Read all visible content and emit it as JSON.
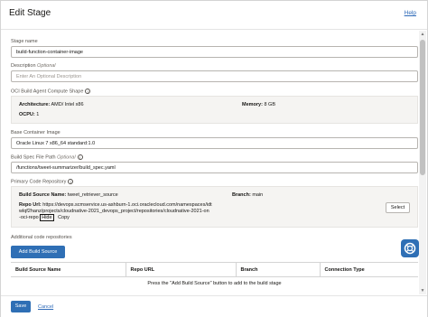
{
  "header": {
    "title": "Edit Stage",
    "help": "Help"
  },
  "stage_name": {
    "label": "Stage name",
    "value": "build-function-container-image"
  },
  "description": {
    "label": "Description",
    "optional": "Optional",
    "placeholder": "Enter An Optional Description"
  },
  "compute_shape": {
    "label": "OCI Build Agent Compute Shape",
    "architecture_label": "Architecture:",
    "architecture_value": "AMD/ Intel x86",
    "memory_label": "Memory:",
    "memory_value": "8 GB",
    "ocpu_label": "OCPU:",
    "ocpu_value": "1"
  },
  "base_image": {
    "label": "Base Container Image",
    "value": "Oracle Linux 7 x86_64 standard:1.0"
  },
  "build_spec": {
    "label": "Build Spec File Path",
    "optional": "Optional",
    "value": "/functions/tweet-summarizer/build_spec.yaml"
  },
  "primary_repo": {
    "label": "Primary Code Repository",
    "source_name_label": "Build Source Name:",
    "source_name_value": "tweet_retriever_source",
    "branch_label": "Branch:",
    "branch_value": "main",
    "repo_url_label": "Repo Url:",
    "repo_url_line1": "https://devops.scmservice.us-ashburn-1.oci.oraclecloud.com/namespaces/idt",
    "repo_url_line2": "wlqf2hanz/projects/cloudnative-2021_devops_project/repositories/cloudnative-2021-on",
    "repo_url_line3": "-oci-repo",
    "hide": "Hide",
    "copy": "Copy",
    "select_button": "Select"
  },
  "additional_repos": {
    "label": "Additional code repositories",
    "add_button": "Add Build Source",
    "columns": [
      "Build Source Name",
      "Repo URL",
      "Branch",
      "Connection Type"
    ],
    "empty_message": "Press the \"Add Build Source\" button to add to the build stage"
  },
  "footer": {
    "save": "Save",
    "cancel": "Cancel"
  },
  "colors": {
    "primary": "#2f6fb5",
    "link": "#2e6ab8"
  }
}
